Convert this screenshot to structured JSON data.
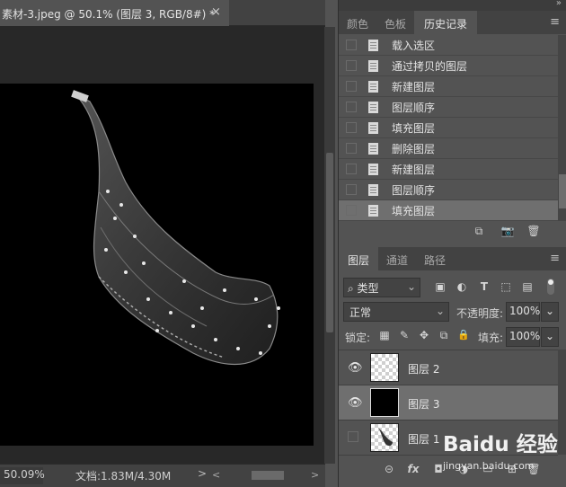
{
  "document": {
    "tab_title": "素材-3.jpeg @ 50.1% (图层 3, RGB/8#) *",
    "close_glyph": "×",
    "zoom": "50.09%",
    "doc_info": "文档:1.83M/4.30M",
    "status_arrow": ">",
    "scroll_left": "<",
    "scroll_right": ">"
  },
  "top_panel": {
    "collapse_glyph": "»",
    "tabs": [
      {
        "label": "颜色",
        "active": false
      },
      {
        "label": "色板",
        "active": false
      },
      {
        "label": "历史记录",
        "active": true
      }
    ],
    "menu_glyph": "≡"
  },
  "history": {
    "items": [
      {
        "label": "载入选区",
        "active": false
      },
      {
        "label": "通过拷贝的图层",
        "active": false
      },
      {
        "label": "新建图层",
        "active": false
      },
      {
        "label": "图层顺序",
        "active": false
      },
      {
        "label": "填充图层",
        "active": false
      },
      {
        "label": "删除图层",
        "active": false
      },
      {
        "label": "新建图层",
        "active": false
      },
      {
        "label": "图层顺序",
        "active": false
      },
      {
        "label": "填充图层",
        "active": true
      }
    ]
  },
  "layers_panel": {
    "tabs": [
      {
        "label": "图层",
        "active": true
      },
      {
        "label": "通道",
        "active": false
      },
      {
        "label": "路径",
        "active": false
      }
    ],
    "menu_glyph": "≡",
    "kind_filter": "类型",
    "filter_icons": [
      "image-filter-icon",
      "adjustment-filter-icon",
      "type-filter-icon",
      "shape-filter-icon",
      "smart-object-filter-icon"
    ],
    "filter_glyphs": {
      "image": "▣",
      "adjust": "◐",
      "type": "T",
      "shape": "⬚",
      "smart": "▤"
    },
    "blend_mode": "正常",
    "opacity_label": "不透明度:",
    "opacity_value": "100%",
    "lock_label": "锁定:",
    "lock_glyphs": {
      "pixels": "▦",
      "paint": "✎",
      "move": "✥",
      "artboard": "⧉",
      "all": "🔒"
    },
    "fill_label": "填充:",
    "fill_value": "100%",
    "dropdown_glyph": "⌄",
    "layers": [
      {
        "name": "图层 2",
        "visible": true,
        "thumb": "checker",
        "active": false
      },
      {
        "name": "图层 3",
        "visible": true,
        "thumb": "black",
        "active": true
      },
      {
        "name": "图层 1",
        "visible": false,
        "thumb": "checker",
        "active": false
      }
    ],
    "footer_glyphs": {
      "link": "⊝",
      "fx": "fx",
      "mask": "◘",
      "adjust": "◑",
      "group": "▭",
      "new": "⊞",
      "delete": "🗑"
    }
  },
  "history_footer_glyphs": {
    "new_doc": "⧉",
    "snapshot": "📷",
    "delete": "🗑"
  },
  "watermark": {
    "brand": "Baidu 经验",
    "sub": "jingyan.baidu.com"
  }
}
